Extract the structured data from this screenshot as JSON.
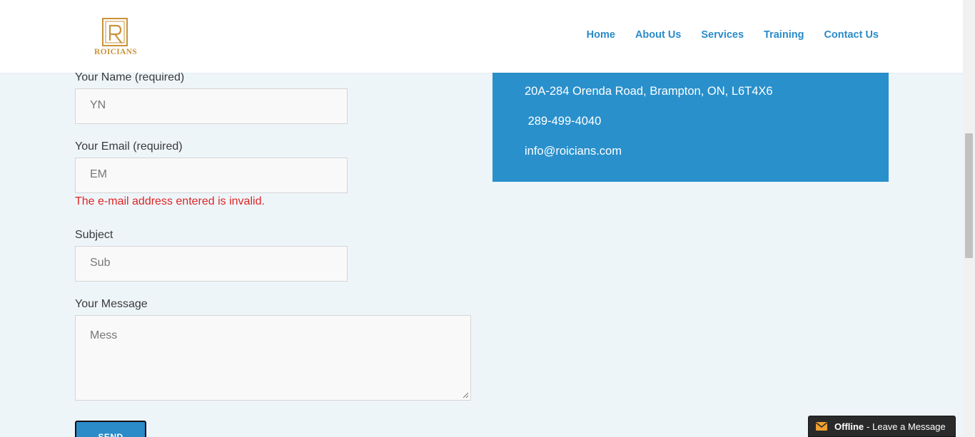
{
  "brand": {
    "logo_text": "ROICIANS",
    "accent": "#c9933a"
  },
  "nav": {
    "items": [
      "Home",
      "About Us",
      "Services",
      "Training",
      "Contact Us"
    ],
    "color": "#2a8bc8"
  },
  "form": {
    "name_label": "Your Name (required)",
    "name_value": "YN",
    "email_label": "Your Email (required)",
    "email_value": "EM",
    "email_error": "The e-mail address entered is invalid.",
    "subject_label": "Subject",
    "subject_value": "Sub",
    "message_label": "Your Message",
    "message_value": "Mess",
    "send_label": "SEND"
  },
  "contact_info": {
    "address": "20A-284 Orenda Road, Brampton, ON, L6T4X6",
    "phone": " 289-499-4040",
    "email": "info@roicians.com",
    "background": "#2990cc"
  },
  "chat_widget": {
    "status": "Offline",
    "text": "- Leave a Message",
    "icon": "envelope-icon"
  },
  "colors": {
    "page_bg": "#eef5f9",
    "error": "#dc2626"
  }
}
